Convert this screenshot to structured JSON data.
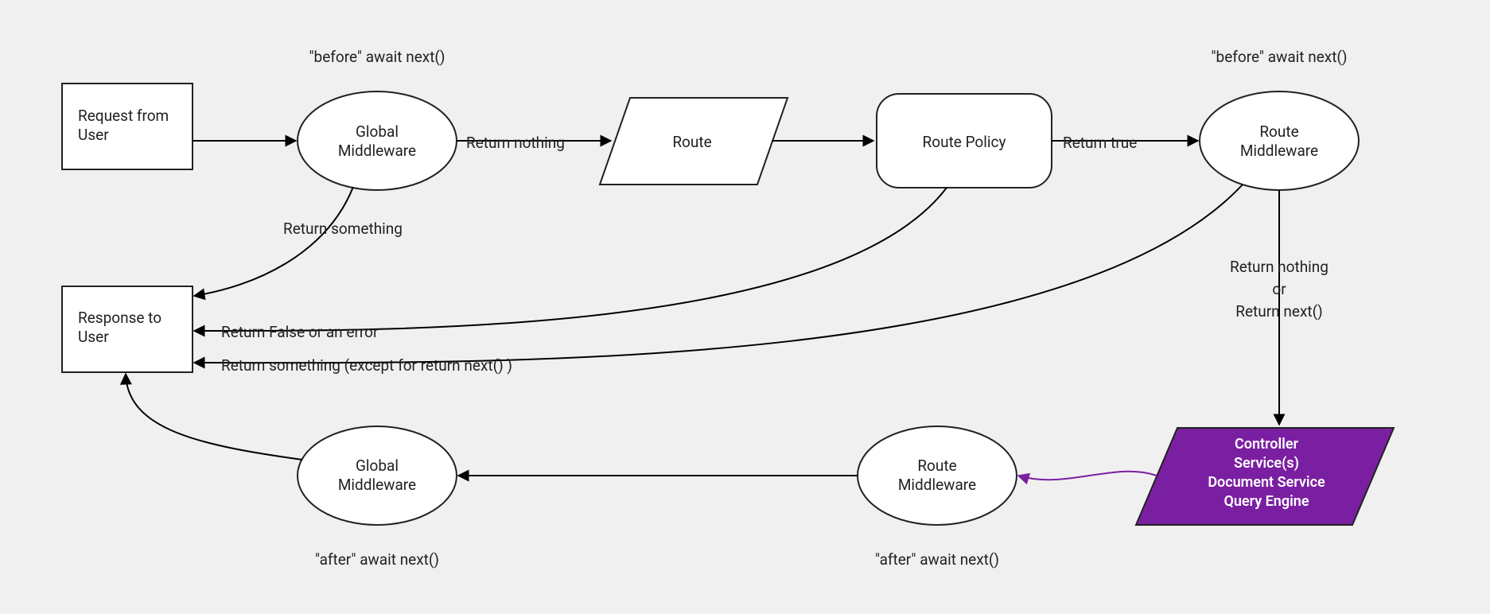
{
  "diagram": {
    "nodes": {
      "request": "Request from User",
      "globalMwBefore": "Global Middleware",
      "route": "Route",
      "routePolicy": "Route Policy",
      "routeMwBefore": "Route Middleware",
      "controllerL1": "Controller",
      "controllerL2": "Service(s)",
      "controllerL3": "Document Service",
      "controllerL4": "Query Engine",
      "routeMwAfter": "Route Middleware",
      "globalMwAfter": "Global Middleware",
      "response": "Response to User"
    },
    "annotations": {
      "gmBefore": "\"before\" await next()",
      "rmBefore": "\"before\" await next()",
      "rmAfter": "\"after\" await next()",
      "gmAfter": "\"after\" await next()"
    },
    "edgeLabels": {
      "gmToRoute": "Return nothing",
      "gmToResponse": "Return something",
      "policyToRm": "Return true",
      "policyToResponse": "Return False or an error",
      "rmToResponse": "Return something (except for return next() )",
      "rmToCtrlL1": "Return nothing",
      "rmToCtrlL2": "or",
      "rmToCtrlL3": "Return next()"
    },
    "colors": {
      "accent": "#7B1FA2",
      "bg": "#f0f0f0"
    }
  }
}
